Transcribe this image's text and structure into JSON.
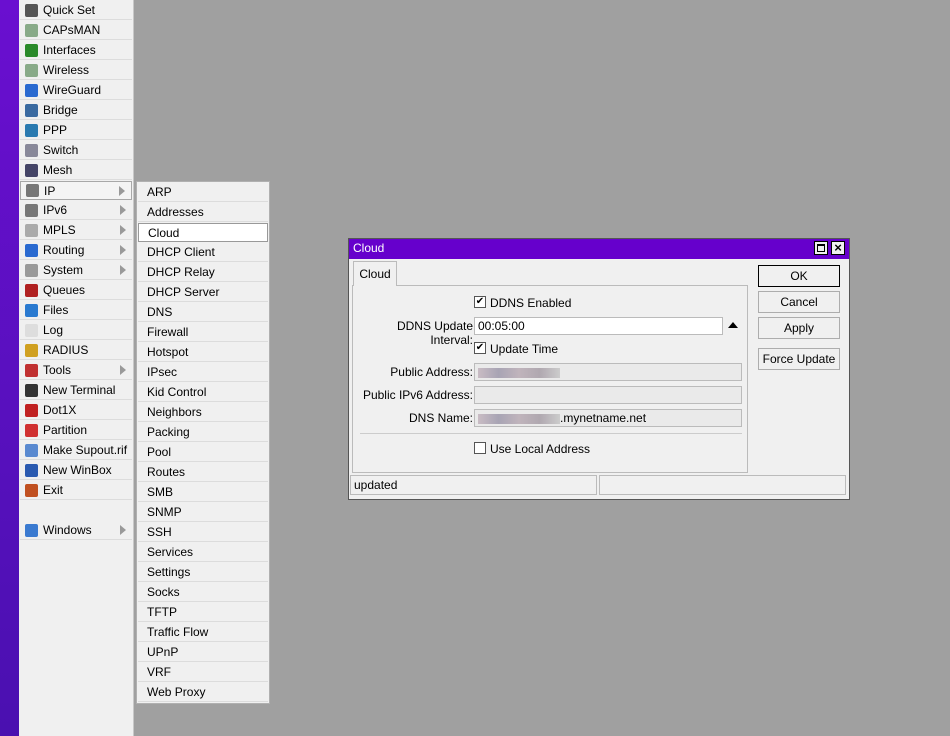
{
  "menu": {
    "items": [
      {
        "label": "Quick Set",
        "icon": "wand-icon",
        "color": "#555"
      },
      {
        "label": "CAPsMAN",
        "icon": "antenna-icon",
        "color": "#8a8"
      },
      {
        "label": "Interfaces",
        "icon": "interfaces-icon",
        "color": "#2a8a2a"
      },
      {
        "label": "Wireless",
        "icon": "antenna-icon",
        "color": "#8a8"
      },
      {
        "label": "WireGuard",
        "icon": "wireguard-icon",
        "color": "#2a6ad0"
      },
      {
        "label": "Bridge",
        "icon": "bridge-icon",
        "color": "#3a6aa0"
      },
      {
        "label": "PPP",
        "icon": "ppp-icon",
        "color": "#2a7ab0"
      },
      {
        "label": "Switch",
        "icon": "switch-icon",
        "color": "#889"
      },
      {
        "label": "Mesh",
        "icon": "mesh-icon",
        "color": "#446"
      },
      {
        "label": "IP",
        "icon": "ip-icon",
        "color": "#777",
        "submenu": true
      },
      {
        "label": "IPv6",
        "icon": "ipv6-icon",
        "color": "#777",
        "submenu": true
      },
      {
        "label": "MPLS",
        "icon": "mpls-icon",
        "color": "#aaa",
        "submenu": true
      },
      {
        "label": "Routing",
        "icon": "routing-icon",
        "color": "#2a6ad0",
        "submenu": true
      },
      {
        "label": "System",
        "icon": "gear-icon",
        "color": "#999",
        "submenu": true
      },
      {
        "label": "Queues",
        "icon": "queues-icon",
        "color": "#b02020"
      },
      {
        "label": "Files",
        "icon": "folder-icon",
        "color": "#2a7ad0"
      },
      {
        "label": "Log",
        "icon": "log-icon",
        "color": "#ddd"
      },
      {
        "label": "RADIUS",
        "icon": "radius-icon",
        "color": "#d0a020"
      },
      {
        "label": "Tools",
        "icon": "tools-icon",
        "color": "#c03030",
        "submenu": true
      },
      {
        "label": "New Terminal",
        "icon": "terminal-icon",
        "color": "#333"
      },
      {
        "label": "Dot1X",
        "icon": "dot1x-icon",
        "color": "#c02020"
      },
      {
        "label": "Partition",
        "icon": "partition-icon",
        "color": "#d03030"
      },
      {
        "label": "Make Supout.rif",
        "icon": "supout-icon",
        "color": "#5a8ad0"
      },
      {
        "label": "New WinBox",
        "icon": "winbox-icon",
        "color": "#2a5ab0"
      },
      {
        "label": "Exit",
        "icon": "exit-icon",
        "color": "#c05020"
      }
    ],
    "windows": "Windows"
  },
  "submenu": {
    "items": [
      "ARP",
      "Addresses",
      "Cloud",
      "DHCP Client",
      "DHCP Relay",
      "DHCP Server",
      "DNS",
      "Firewall",
      "Hotspot",
      "IPsec",
      "Kid Control",
      "Neighbors",
      "Packing",
      "Pool",
      "Routes",
      "SMB",
      "SNMP",
      "SSH",
      "Services",
      "Settings",
      "Socks",
      "TFTP",
      "Traffic Flow",
      "UPnP",
      "VRF",
      "Web Proxy"
    ],
    "selected": "Cloud"
  },
  "dialog": {
    "title": "Cloud",
    "tab": "Cloud",
    "ddns_enabled": {
      "label": "DDNS Enabled",
      "checked": true
    },
    "interval": {
      "label": "DDNS Update Interval:",
      "value": "00:05:00"
    },
    "update_time": {
      "label": "Update Time",
      "checked": true
    },
    "public_address": {
      "label": "Public Address:"
    },
    "public_ipv6": {
      "label": "Public IPv6 Address:",
      "value": ""
    },
    "dns_name": {
      "label": "DNS Name:",
      "suffix": ".mynetname.net"
    },
    "use_local": {
      "label": "Use Local Address",
      "checked": false
    },
    "buttons": {
      "ok": "OK",
      "cancel": "Cancel",
      "apply": "Apply",
      "force": "Force Update"
    },
    "status": "updated",
    "check": "✔"
  }
}
